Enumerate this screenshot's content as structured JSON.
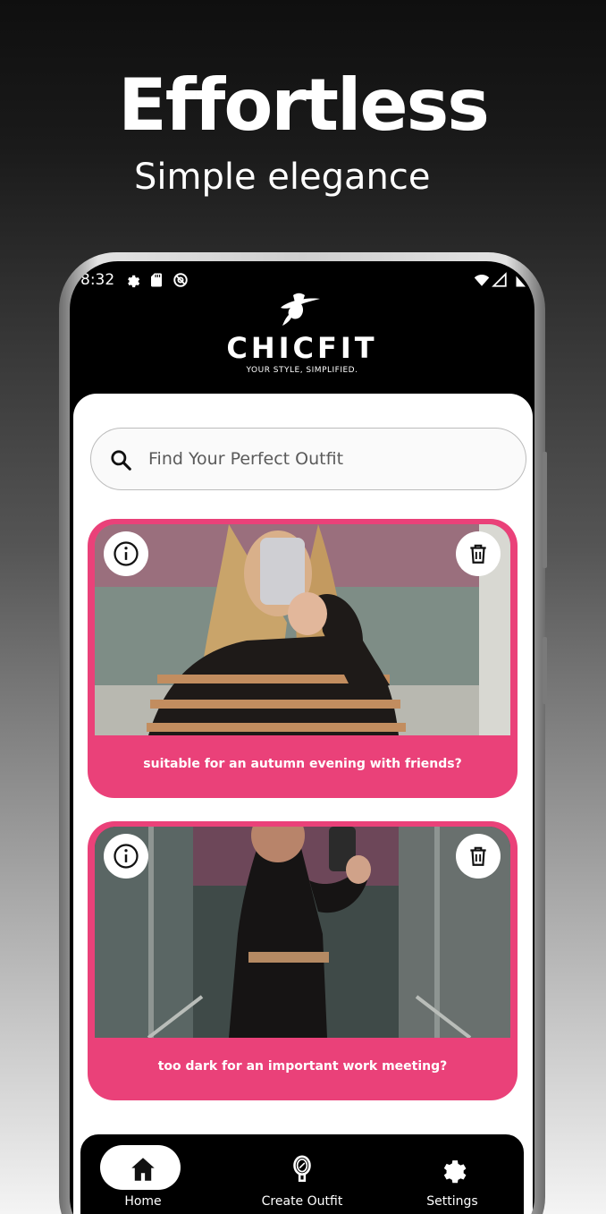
{
  "promo": {
    "headline": "Effortless",
    "subheadline": "Simple elegance"
  },
  "status_bar": {
    "time": "8:32",
    "icons": [
      "gear-icon",
      "sd-card-icon",
      "sync-icon",
      "wifi-icon",
      "signal-icon",
      "battery-icon"
    ]
  },
  "app": {
    "logo_icon": "woman-hat-logo-icon",
    "name": "CHICFIT",
    "tagline": "YOUR STYLE, SIMPLIFIED."
  },
  "search": {
    "placeholder": "Find Your Perfect Outfit",
    "value": ""
  },
  "outfits": [
    {
      "caption": "suitable for an autumn evening with friends?",
      "info_icon": "info-icon",
      "delete_icon": "trash-icon"
    },
    {
      "caption": "too dark for an important work meeting?",
      "info_icon": "info-icon",
      "delete_icon": "trash-icon"
    }
  ],
  "nav": {
    "items": [
      {
        "label": "Home",
        "icon": "home-icon",
        "active": true
      },
      {
        "label": "Create Outfit",
        "icon": "mirror-icon",
        "active": false
      },
      {
        "label": "Settings",
        "icon": "gear-icon",
        "active": false
      }
    ]
  },
  "colors": {
    "accent": "#ea4179",
    "background": "#ffffff",
    "header": "#000000"
  }
}
